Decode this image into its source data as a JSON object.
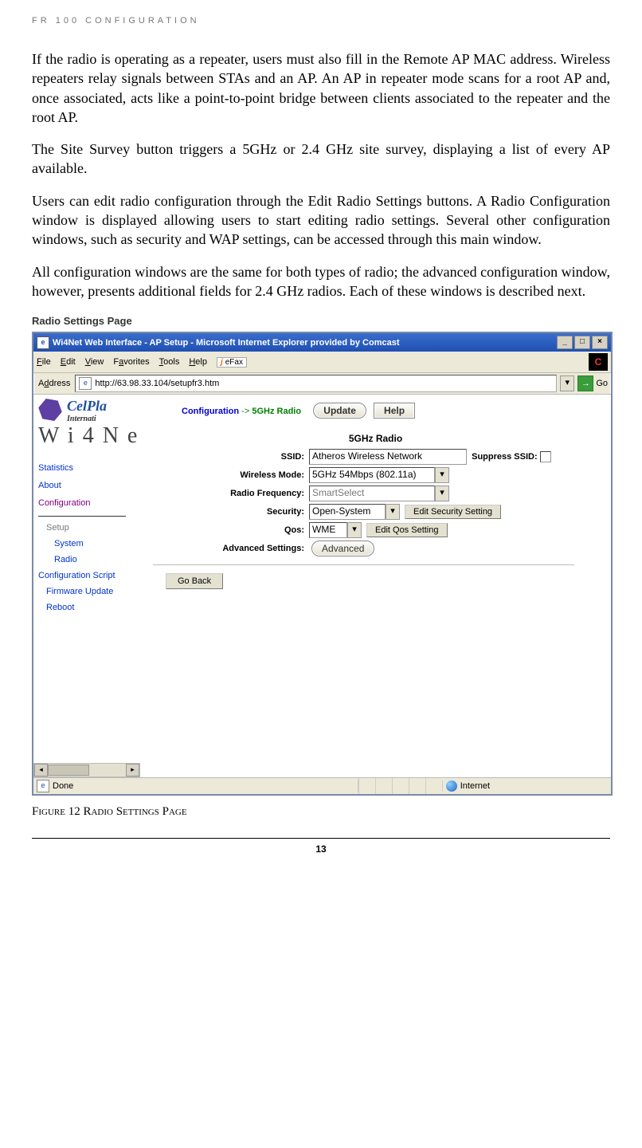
{
  "header": "FR 100 CONFIGURATION",
  "paragraphs": {
    "p1": "If the radio is operating as a repeater, users must also fill in the Remote AP MAC address. Wireless repeaters relay signals between STAs and an AP. An AP in repeater mode scans for a root AP and, once associated, acts like a point-to-point bridge between clients associated to the repeater and the root AP.",
    "p2": "The Site Survey button triggers a 5GHz or 2.4 GHz site survey, displaying a list of every AP available.",
    "p3": "Users can edit radio configuration through the Edit Radio Settings buttons. A Radio Configuration window is displayed allowing users to start editing radio settings. Several other configuration windows, such as security and WAP settings, can be accessed through this main window.",
    "p4": "All configuration windows are the same for both types of radio; the advanced configuration window, however, presents additional fields for 2.4 GHz radios. Each of these windows is described next."
  },
  "subhead": "Radio Settings Page",
  "caption": "Figure 12 Radio Settings Page",
  "page_number": "13",
  "browser": {
    "title": "Wi4Net Web Interface - AP Setup - Microsoft Internet Explorer provided by Comcast",
    "menu": {
      "file": "File",
      "edit": "Edit",
      "view": "View",
      "favorites": "Favorites",
      "tools": "Tools",
      "help": "Help",
      "efax": "eFax"
    },
    "address_label": "Address",
    "url": "http://63.98.33.104/setupfr3.htm",
    "go": "Go",
    "status_done": "Done",
    "status_zone": "Internet"
  },
  "celplan": {
    "name": "CelPla",
    "sub": "Internati"
  },
  "wi4text": "W i 4 N e",
  "nav": {
    "statistics": "Statistics",
    "about": "About",
    "configuration": "Configuration",
    "setup": "Setup",
    "system": "System",
    "radio": "Radio",
    "cfgscript": "Configuration Script",
    "firmware": "Firmware Update",
    "reboot": "Reboot"
  },
  "breadcrumb": {
    "cfg": "Configuration",
    "arrow": "->",
    "radio": "5GHz Radio"
  },
  "buttons": {
    "update": "Update",
    "help": "Help",
    "edit_security": "Edit Security Setting",
    "edit_qos": "Edit Qos Setting",
    "advanced": "Advanced",
    "goback": "Go Back"
  },
  "form": {
    "section_title": "5GHz Radio",
    "ssid_label": "SSID:",
    "ssid_value": "Atheros Wireless Network",
    "suppress_label": "Suppress SSID:",
    "mode_label": "Wireless Mode:",
    "mode_value": "5GHz 54Mbps (802.11a)",
    "freq_label": "Radio Frequency:",
    "freq_value": "SmartSelect",
    "security_label": "Security:",
    "security_value": "Open-System",
    "qos_label": "Qos:",
    "qos_value": "WME",
    "adv_label": "Advanced Settings:"
  }
}
